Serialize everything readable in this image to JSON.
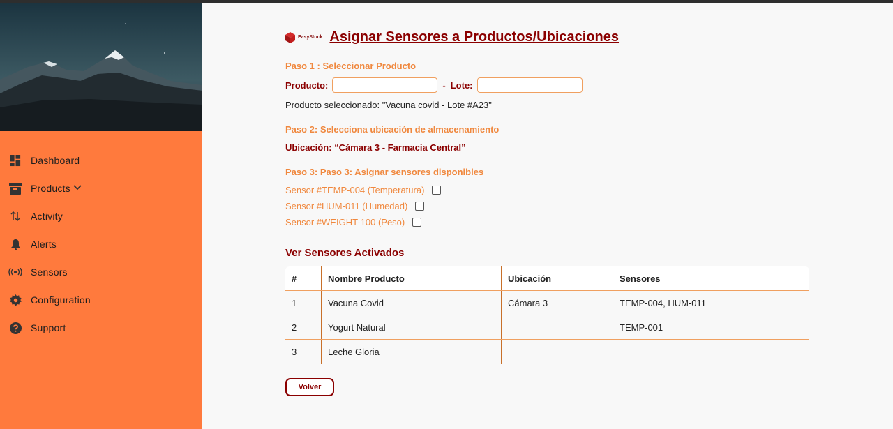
{
  "sidebar": {
    "items": [
      {
        "label": "Dashboard",
        "icon": "dashboard-icon"
      },
      {
        "label": "Products",
        "icon": "archive-icon"
      },
      {
        "label": "Activity",
        "icon": "swap-vertical-icon"
      },
      {
        "label": "Alerts",
        "icon": "bell-icon"
      },
      {
        "label": "Sensors",
        "icon": "sensors-icon"
      },
      {
        "label": "Configuration",
        "icon": "gear-icon"
      },
      {
        "label": "Support",
        "icon": "help-icon"
      }
    ]
  },
  "header": {
    "logo_text": "EasyStock",
    "title": "Asignar Sensores a Productos/Ubicaciones"
  },
  "step1": {
    "title": "Paso 1 : Seleccionar Producto",
    "product_label": "Producto:",
    "product_value": "",
    "separator": "-",
    "lote_label": "Lote:",
    "lote_value": "",
    "selected_text": "Producto seleccionado: \"Vacuna covid - Lote #A23\""
  },
  "step2": {
    "title": "Paso 2: Selecciona ubicación de almacenamiento",
    "location_text": "Ubicación: “Cámara 3 - Farmacia Central”"
  },
  "step3": {
    "title": "Paso 3: Paso 3: Asignar sensores disponibles",
    "sensors": [
      {
        "label": "Sensor #TEMP-004 (Temperatura)",
        "checked": false
      },
      {
        "label": "Sensor #HUM-011 (Humedad)",
        "checked": false
      },
      {
        "label": "Sensor #WEIGHT-100 (Peso)",
        "checked": false
      }
    ]
  },
  "table": {
    "title": "Ver Sensores Activados",
    "headers": [
      "#",
      "Nombre Producto",
      "Ubicación",
      "Sensores"
    ],
    "rows": [
      [
        "1",
        "Vacuna Covid",
        "Cámara 3",
        "TEMP-004, HUM-011"
      ],
      [
        "2",
        "Yogurt Natural",
        "",
        "TEMP-001"
      ],
      [
        "3",
        "Leche Gloria",
        "",
        ""
      ]
    ]
  },
  "back_button": "Volver",
  "colors": {
    "sidebar_bg": "#ff7a3d",
    "accent_orange": "#f0883e",
    "dark_red": "#8b0000"
  }
}
